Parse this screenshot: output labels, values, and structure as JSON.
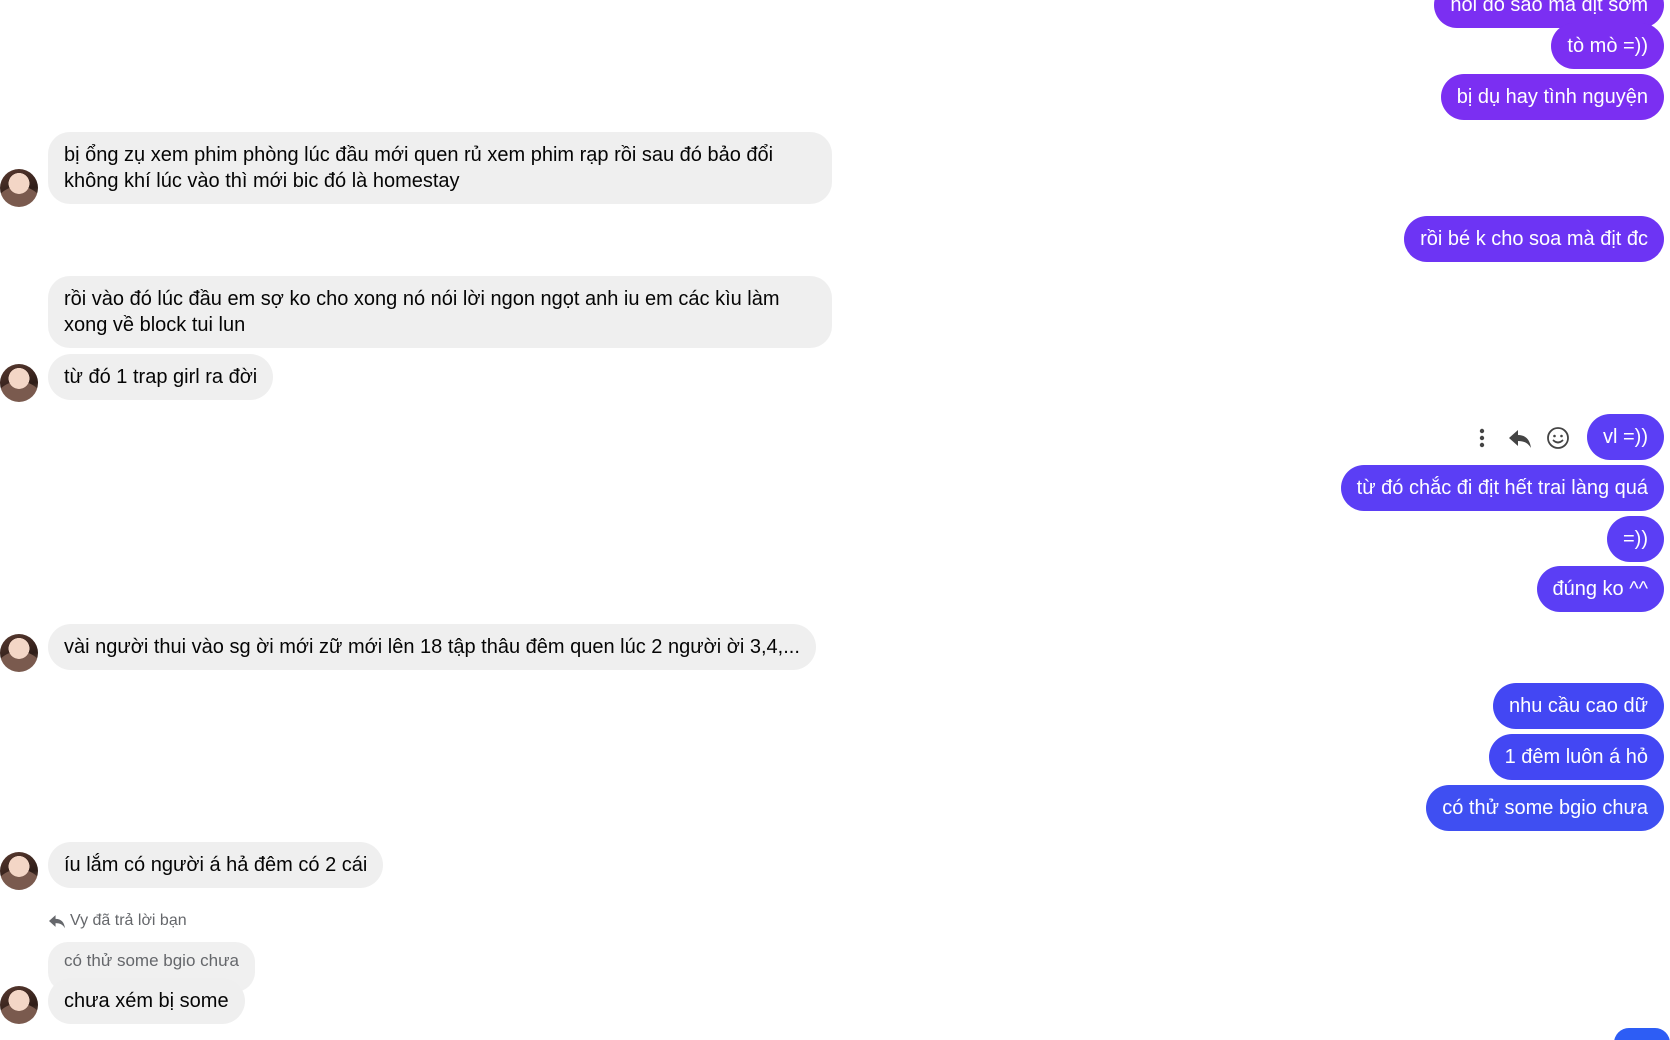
{
  "conversation": {
    "contact_name": "Vy",
    "colors": {
      "incoming_bg": "#efefef",
      "incoming_text": "#050505",
      "outgoing_purple": "#7b2ff2",
      "outgoing_violet": "#5b3ef5",
      "outgoing_blue": "#3f4ff2",
      "meta_text": "#65676b"
    },
    "messages": {
      "out_partial": "hỏi đó sao mà địt sớm",
      "out_to_mo": "tò mò =))",
      "out_bi_du": "bị dụ hay tình nguyện",
      "in_bi_ong_zu": "bị ổng zụ xem phim phòng lúc đầu mới quen rủ xem phim rạp rồi sau đó bảo đổi không khí lúc vào thì mới bic đó là homestay",
      "out_roi_be": "rồi bé k cho soa mà địt đc",
      "in_roi_vao_do": "rồi vào đó lúc đầu em sợ ko cho xong nó nói lời ngon ngọt anh iu em các kìu làm xong về block tui lun",
      "in_tu_do_trap": "từ đó 1 trap girl ra đời",
      "out_vl": "vl =))",
      "out_tu_do_chac": "từ đó chắc đi địt hết trai làng quá",
      "out_laugh": "=))",
      "out_dung_ko": "đúng ko ^^",
      "in_vai_nguoi": "vài người thui vào sg ời mới zữ mới lên 18 tập thâu đêm quen lúc 2 người ời 3,4,...",
      "out_nhu_cau": "nhu cầu cao dữ",
      "out_1_dem": "1 đêm luôn á hỏ",
      "out_co_thu": "có thử some bgio chưa",
      "in_iu_lam": "íu lắm có người á hả đêm có 2 cái",
      "in_chua_xem": "chưa xém bị some"
    },
    "reply": {
      "label": "Vy đã trả lời bạn",
      "quoted_text": "có thử some bgio chưa"
    },
    "hover_actions": {
      "more_icon": "more-vertical-icon",
      "reply_icon": "reply-icon",
      "react_icon": "smiley-icon"
    }
  }
}
